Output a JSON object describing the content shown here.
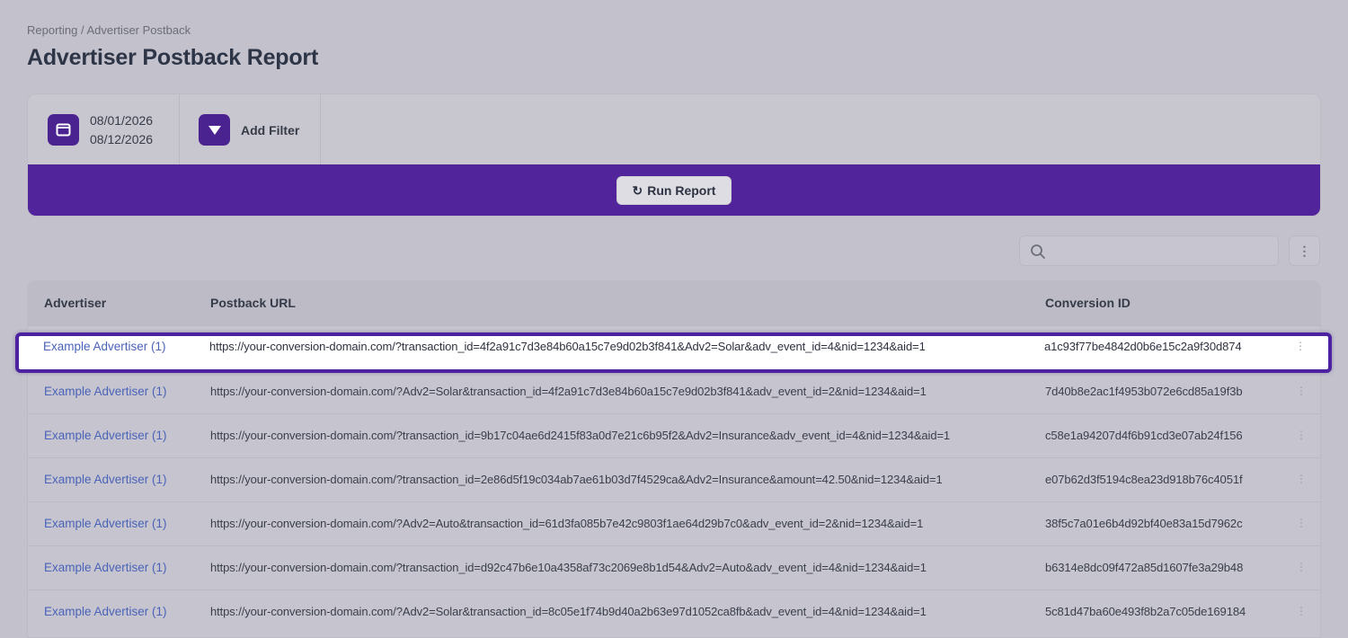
{
  "breadcrumb": "Reporting / Advertiser Postback",
  "page_title": "Advertiser Postback Report",
  "filters": {
    "date_start": "08/01/2026",
    "date_end": "08/12/2026",
    "add_filter_label": "Add Filter",
    "run_report_label": "Run Report"
  },
  "search": {
    "placeholder": ""
  },
  "table": {
    "columns": [
      "Advertiser",
      "Postback URL",
      "Conversion ID"
    ],
    "rows": [
      {
        "advertiser": "Example Advertiser (1)",
        "url": "https://your-conversion-domain.com/?transaction_id=4f2a91c7d3e84b60a15c7e9d02b3f841&Adv2=Solar&adv_event_id=4&nid=1234&aid=1",
        "conversion_id": "a1c93f77be4842d0b6e15c2a9f30d874"
      },
      {
        "advertiser": "Example Advertiser (1)",
        "url": "https://your-conversion-domain.com/?Adv2=Solar&transaction_id=4f2a91c7d3e84b60a15c7e9d02b3f841&adv_event_id=2&nid=1234&aid=1",
        "conversion_id": "7d40b8e2ac1f4953b072e6cd85a19f3b"
      },
      {
        "advertiser": "Example Advertiser (1)",
        "url": "https://your-conversion-domain.com/?transaction_id=9b17c04ae6d2415f83a0d7e21c6b95f2&Adv2=Insurance&adv_event_id=4&nid=1234&aid=1",
        "conversion_id": "c58e1a94207d4f6b91cd3e07ab24f156"
      },
      {
        "advertiser": "Example Advertiser (1)",
        "url": "https://your-conversion-domain.com/?transaction_id=2e86d5f19c034ab7ae61b03d7f4529ca&Adv2=Insurance&amount=42.50&nid=1234&aid=1",
        "conversion_id": "e07b62d3f5194c8ea23d918b76c4051f"
      },
      {
        "advertiser": "Example Advertiser (1)",
        "url": "https://your-conversion-domain.com/?Adv2=Auto&transaction_id=61d3fa085b7e42c9803f1ae64d29b7c0&adv_event_id=2&nid=1234&aid=1",
        "conversion_id": "38f5c7a01e6b4d92bf40e83a15d7962c"
      },
      {
        "advertiser": "Example Advertiser (1)",
        "url": "https://your-conversion-domain.com/?transaction_id=d92c47b6e10a4358af73c2069e8b1d54&Adv2=Auto&adv_event_id=4&nid=1234&aid=1",
        "conversion_id": "b6314e8dc09f472a85d1607fe3a29b48"
      },
      {
        "advertiser": "Example Advertiser (1)",
        "url": "https://your-conversion-domain.com/?Adv2=Solar&transaction_id=8c05e1f74b9d40a2b63e97d1052ca8fb&adv_event_id=4&nid=1234&aid=1",
        "conversion_id": "5c81d47ba60e493f8b2a7c05de169184"
      }
    ]
  },
  "icons": {
    "calendar": "calendar-icon",
    "filter": "filter-icon",
    "refresh": "refresh-icon",
    "search": "search-icon",
    "more": "more-vertical-icon"
  },
  "colors": {
    "accent": "#52249b",
    "highlight_border": "#4c22a0",
    "link": "#4a63b8"
  }
}
